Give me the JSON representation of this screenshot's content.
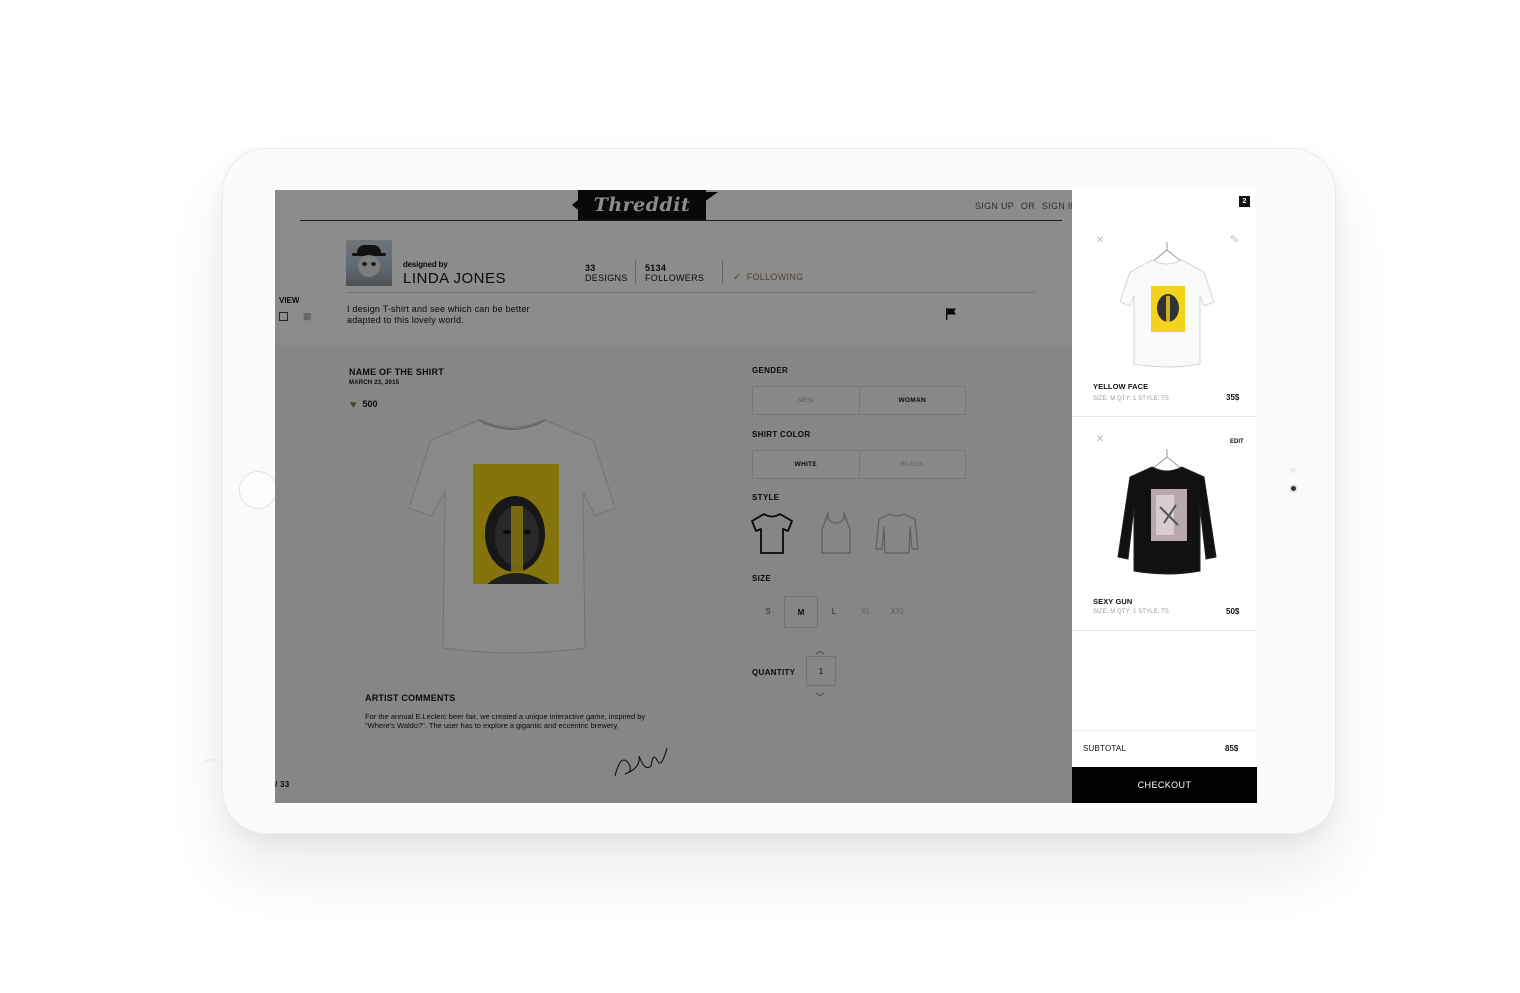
{
  "header": {
    "logo": "Threddit",
    "sign_up": "SIGN UP",
    "or": "OR",
    "sign_in": "SIGN IN"
  },
  "profile": {
    "designed_by": "designed by",
    "name": "LINDA JONES",
    "designs_count": "33",
    "designs_label": "DESIGNS",
    "followers_count": "5134",
    "followers_label": "FOLLOWERS",
    "following_label": "FOLLOWING",
    "bio": "I design T-shirt and see which can be better adapted to this lovely world."
  },
  "view": {
    "label": "VIEW"
  },
  "product": {
    "name": "NAME OF THE SHIRT",
    "date": "MARCH 23, 2015",
    "likes": "500"
  },
  "options": {
    "gender_label": "GENDER",
    "gender_options": [
      "MEN",
      "WOMAN"
    ],
    "gender_selected": "WOMAN",
    "color_label": "SHIRT COLOR",
    "color_options": [
      "WHITE",
      "BLACK"
    ],
    "color_selected": "WHITE",
    "style_label": "STYLE",
    "style_options": [
      "t-shirt-icon",
      "tank-top-icon",
      "sweatshirt-icon"
    ],
    "size_label": "SIZE",
    "sizes": [
      "S",
      "M",
      "L",
      "XL",
      "XXL"
    ],
    "size_selected": "M",
    "quantity_label": "QUANTITY",
    "quantity": "1"
  },
  "artist": {
    "title": "ARTIST COMMENTS",
    "text": "For the annual E.Leclerc beer fair, we created a unique interactive game, inspired by \"Where's Waldo?\". The user has to explore a gigantic and eccentric brewery,"
  },
  "pager": {
    "text": "/ 33"
  },
  "cart": {
    "count": "2",
    "items": [
      {
        "name": "YELLOW FACE",
        "detail": "SIZE: M   QTY: 1   STYLE: TS",
        "price": "35$",
        "action": "pencil-icon"
      },
      {
        "name": "SEXY GUN",
        "detail": "SIZE: M   QTY: 1   STYLE: TS",
        "price": "50$",
        "action": "EDIT"
      }
    ],
    "subtotal_label": "SUBTOTAL",
    "subtotal_value": "85$",
    "checkout_label": "CHECKOUT"
  },
  "colors": {
    "accent_gold": "#8a7a55",
    "print_yellow": "#f2d21a",
    "checkout_bg": "#000000"
  }
}
